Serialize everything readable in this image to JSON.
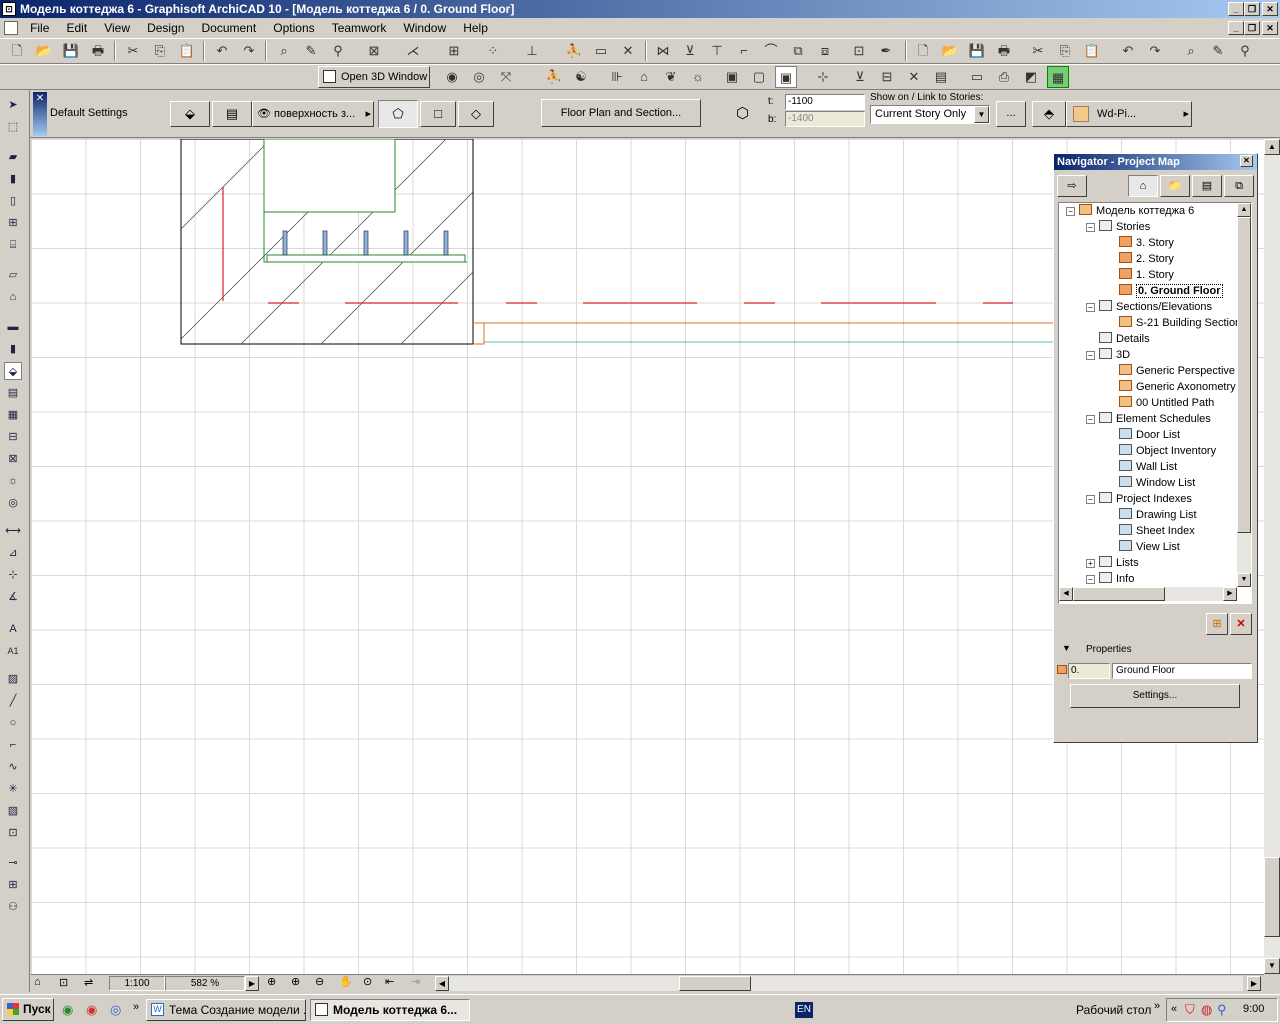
{
  "window": {
    "title": "Модель коттеджа 6 - Graphisoft ArchiCAD 10 - [Модель коттеджа 6 / 0. Ground Floor]"
  },
  "menu": [
    "File",
    "Edit",
    "View",
    "Design",
    "Document",
    "Options",
    "Teamwork",
    "Window",
    "Help"
  ],
  "toolbar2": {
    "open3d_label": "Open 3D Window"
  },
  "infobox": {
    "default_settings": "Default Settings",
    "surface_label": "поверхность з...",
    "floor_plan_button": "Floor Plan and Section...",
    "t_label": "t:",
    "b_label": "b:",
    "t_value": "-1100",
    "b_value": "-1400",
    "show_on_label": "Show on / Link to Stories:",
    "show_on_value": "Current Story Only",
    "ellipsis_button": "...",
    "material_label": "Wd-Pi..."
  },
  "navigator": {
    "title": "Navigator - Project Map",
    "tree": [
      {
        "label": "Модель коттеджа 6",
        "level": 0,
        "icon": "project-icon"
      },
      {
        "label": "Stories",
        "level": 1,
        "icon": "stories-icon"
      },
      {
        "label": "3. Story",
        "level": 2,
        "icon": "story-icon"
      },
      {
        "label": "2. Story",
        "level": 2,
        "icon": "story-icon"
      },
      {
        "label": "1. Story",
        "level": 2,
        "icon": "story-icon"
      },
      {
        "label": "0. Ground Floor",
        "level": 2,
        "icon": "story-icon",
        "selected": true
      },
      {
        "label": "Sections/Elevations",
        "level": 1,
        "icon": "sections-icon"
      },
      {
        "label": "S-21 Building Section",
        "level": 2,
        "icon": "section-icon"
      },
      {
        "label": "Details",
        "level": 1,
        "icon": "details-icon"
      },
      {
        "label": "3D",
        "level": 1,
        "icon": "3d-icon"
      },
      {
        "label": "Generic Perspective",
        "level": 2,
        "icon": "perspective-icon"
      },
      {
        "label": "Generic Axonometry",
        "level": 2,
        "icon": "axonometry-icon"
      },
      {
        "label": "00 Untitled Path",
        "level": 2,
        "icon": "path-icon"
      },
      {
        "label": "Element Schedules",
        "level": 1,
        "icon": "schedules-icon"
      },
      {
        "label": "Door List",
        "level": 2,
        "icon": "schedule-icon"
      },
      {
        "label": "Object Inventory",
        "level": 2,
        "icon": "schedule-icon"
      },
      {
        "label": "Wall List",
        "level": 2,
        "icon": "schedule-icon"
      },
      {
        "label": "Window List",
        "level": 2,
        "icon": "schedule-icon"
      },
      {
        "label": "Project Indexes",
        "level": 1,
        "icon": "indexes-icon"
      },
      {
        "label": "Drawing List",
        "level": 2,
        "icon": "index-icon"
      },
      {
        "label": "Sheet Index",
        "level": 2,
        "icon": "index-icon"
      },
      {
        "label": "View List",
        "level": 2,
        "icon": "index-icon"
      },
      {
        "label": "Lists",
        "level": 1,
        "icon": "lists-icon"
      },
      {
        "label": "Info",
        "level": 1,
        "icon": "info-icon"
      }
    ],
    "properties_label": "Properties",
    "story_number": "0.",
    "story_name": "Ground Floor",
    "settings_button": "Settings..."
  },
  "statusbar": {
    "scale": "1:100",
    "zoom": "582 %"
  },
  "taskbar": {
    "start": "Пуск",
    "tasks": [
      "Тема Создание модели ...",
      "Модель коттеджа 6..."
    ],
    "language": "EN",
    "desktop": "Рабочий стол",
    "clock": "9:00"
  }
}
